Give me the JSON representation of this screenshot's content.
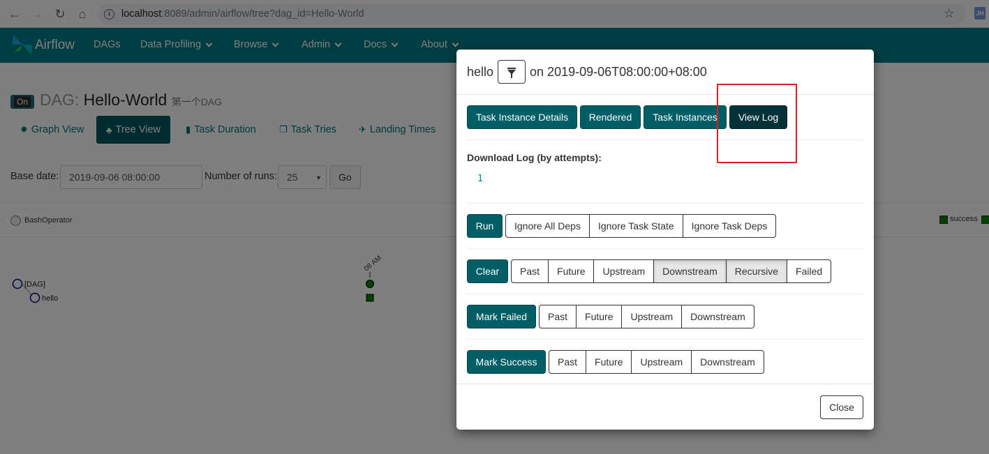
{
  "browser": {
    "url_host": "localhost",
    "url_rest": ":8089/admin/airflow/tree?dag_id=Hello-World",
    "profile_badge": "JH"
  },
  "navbar": {
    "brand": "Airflow",
    "items": [
      {
        "label": "DAGs",
        "has_caret": false
      },
      {
        "label": "Data Profiling",
        "has_caret": true
      },
      {
        "label": "Browse",
        "has_caret": true
      },
      {
        "label": "Admin",
        "has_caret": true
      },
      {
        "label": "Docs",
        "has_caret": true
      },
      {
        "label": "About",
        "has_caret": true
      }
    ]
  },
  "dag": {
    "toggle": "On",
    "prefix": "DAG:",
    "id": "Hello-World",
    "description": "第一个DAG"
  },
  "tabs": [
    {
      "label": "Graph View",
      "icon": "graph-icon"
    },
    {
      "label": "Tree View",
      "icon": "tree-icon",
      "active": true
    },
    {
      "label": "Task Duration",
      "icon": "bar-chart-icon"
    },
    {
      "label": "Task Tries",
      "icon": "duplicate-icon"
    },
    {
      "label": "Landing Times",
      "icon": "plane-icon"
    }
  ],
  "form": {
    "base_date_label": "Base date:",
    "base_date_value": "2019-09-06 08:00:00",
    "runs_label": "Number of runs:",
    "runs_value": "25",
    "go_label": "Go"
  },
  "legend": {
    "operator": "BashOperator",
    "state": "success",
    "state_color": "#008000"
  },
  "tree": {
    "time_label": "08 AM",
    "nodes": [
      "[DAG]",
      "hello"
    ]
  },
  "modal": {
    "task": "hello",
    "on_text": "on 2019-09-06T08:00:00+08:00",
    "top_buttons": [
      "Task Instance Details",
      "Rendered",
      "Task Instances",
      "View Log"
    ],
    "download_title": "Download Log (by attempts):",
    "attempts": [
      "1"
    ],
    "run": {
      "label": "Run",
      "options": [
        "Ignore All Deps",
        "Ignore Task State",
        "Ignore Task Deps"
      ]
    },
    "clear": {
      "label": "Clear",
      "options": [
        "Past",
        "Future",
        "Upstream",
        "Downstream",
        "Recursive",
        "Failed"
      ]
    },
    "mark_failed": {
      "label": "Mark Failed",
      "options": [
        "Past",
        "Future",
        "Upstream",
        "Downstream"
      ]
    },
    "mark_success": {
      "label": "Mark Success",
      "options": [
        "Past",
        "Future",
        "Upstream",
        "Downstream"
      ]
    },
    "close": "Close"
  },
  "colors": {
    "navbar": "#007a87",
    "primary_button": "#005e66",
    "highlight": "#e0201b"
  }
}
